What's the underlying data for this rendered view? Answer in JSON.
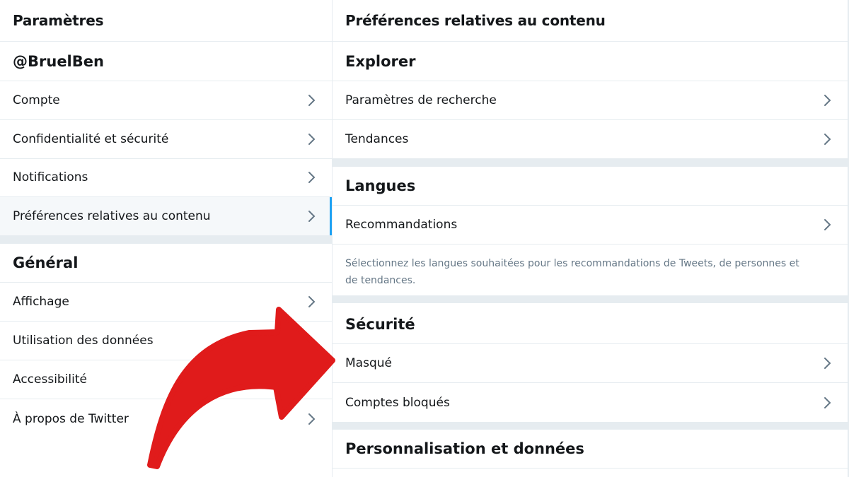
{
  "left": {
    "header": "Paramètres",
    "account_handle": "@BruelBen",
    "account_items": [
      {
        "label": "Compte"
      },
      {
        "label": "Confidentialité et sécurité"
      },
      {
        "label": "Notifications"
      },
      {
        "label": "Préférences relatives au contenu"
      }
    ],
    "general_title": "Général",
    "general_items": [
      {
        "label": "Affichage"
      },
      {
        "label": "Utilisation des données"
      },
      {
        "label": "Accessibilité"
      },
      {
        "label": "À propos de Twitter"
      }
    ]
  },
  "right": {
    "header": "Préférences relatives au contenu",
    "explorer": {
      "title": "Explorer",
      "items": [
        {
          "label": "Paramètres de recherche"
        },
        {
          "label": "Tendances"
        }
      ]
    },
    "langues": {
      "title": "Langues",
      "items": [
        {
          "label": "Recommandations"
        }
      ],
      "description": "Sélectionnez les langues souhaitées pour les recommandations de Tweets, de personnes et de tendances."
    },
    "securite": {
      "title": "Sécurité",
      "items": [
        {
          "label": "Masqué"
        },
        {
          "label": "Comptes bloqués"
        }
      ]
    },
    "perso_title": "Personnalisation et données"
  },
  "colors": {
    "accent": "#1da1f2",
    "annotation_arrow": "#e01b1b"
  },
  "icons": {
    "row_chevron": "chevron-right-icon",
    "annotation": "curved-arrow-icon"
  }
}
